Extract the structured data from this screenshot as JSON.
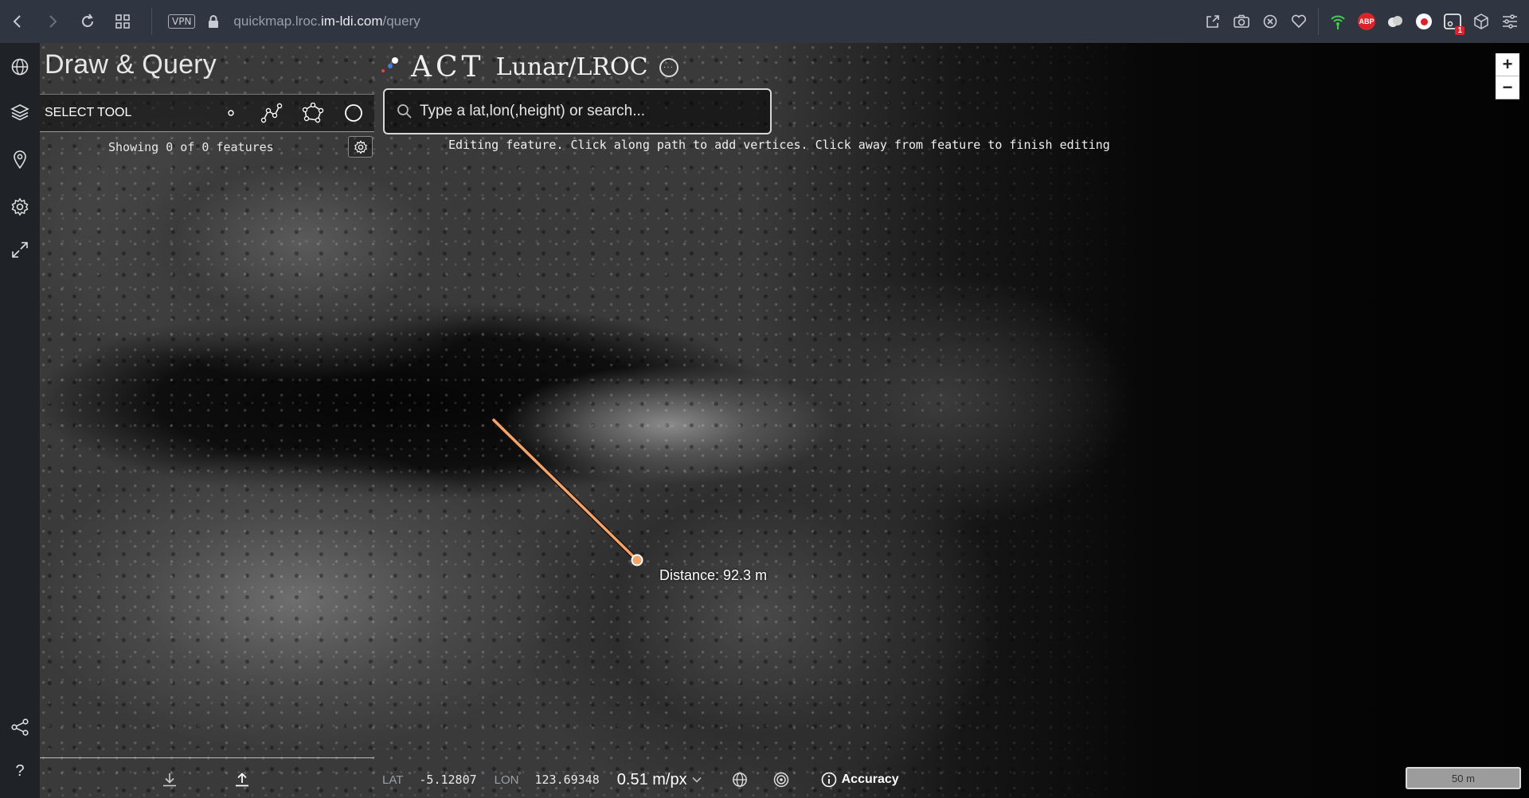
{
  "browser": {
    "vpn_label": "VPN",
    "url_prefix": "quickmap.lroc.",
    "url_domain": "im-ldi.com",
    "url_path": "/query",
    "extension_badge": "1"
  },
  "panel": {
    "title": "Draw & Query",
    "select_tool_label": "SELECT TOOL",
    "showing_text": "Showing 0 of 0 features"
  },
  "header": {
    "logo_act": "ACT",
    "logo_sub": "Lunar/LROC",
    "logo_circle": "···"
  },
  "search": {
    "placeholder": "Type a lat,lon(,height) or search..."
  },
  "edit_message": "Editing feature. Click along path to add vertices. Click away from feature to finish editing",
  "zoom": {
    "in_label": "+",
    "out_label": "−"
  },
  "measurement": {
    "distance_label": "Distance: 92.3 m"
  },
  "status": {
    "lat_label": "LAT",
    "lat_value": "-5.12807",
    "lon_label": "LON",
    "lon_value": "123.69348",
    "scale_value": "0.51 m/px",
    "accuracy_label": "Accuracy",
    "scalebar_label": "50 m"
  },
  "help_label": "?",
  "colors": {
    "measure_line": "#f2a56b",
    "chrome_bg": "#2f3642",
    "rail_bg": "#1f2227"
  }
}
